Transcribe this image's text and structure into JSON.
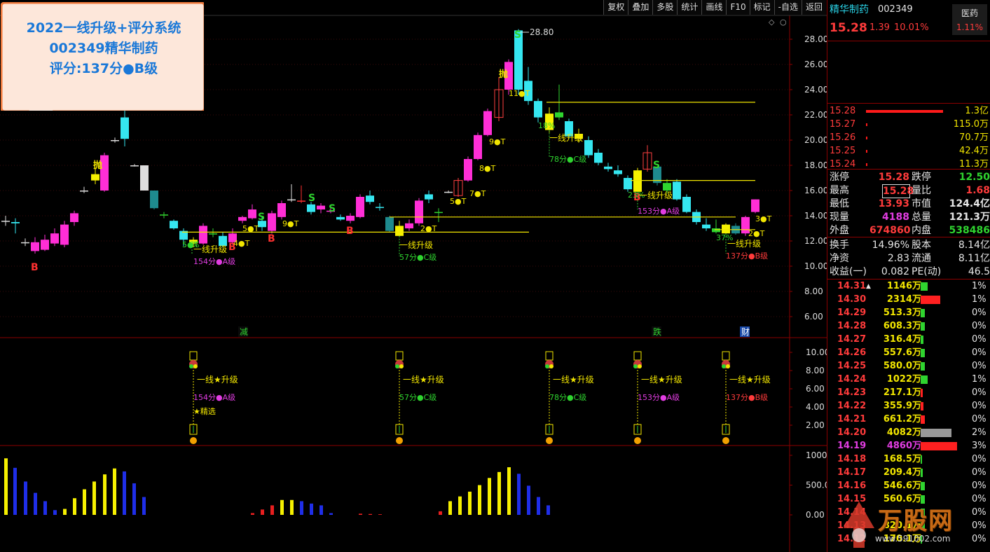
{
  "toolbar": {
    "items": [
      "复权",
      "叠加",
      "多股",
      "统计",
      "画线",
      "F10",
      "标记",
      "-自选",
      "返回"
    ]
  },
  "bubble": {
    "line1": "2022一线升级+评分系统",
    "line2": "002349精华制药",
    "line3": "评分:137分●B级"
  },
  "main_chart": {
    "price_axis": [
      "28.00",
      "26.00",
      "24.00",
      "22.00",
      "20.00",
      "18.00",
      "16.00",
      "14.00",
      "12.00",
      "10.00",
      "8.00",
      "6.00"
    ],
    "peak_label": "28.80",
    "annotations": {
      "pao1": "抛",
      "pao2": "抛",
      "s_labels": [
        "S",
        "S",
        "S",
        "S",
        "S"
      ],
      "b_labels": [
        "B",
        "B",
        "B",
        "B",
        "B"
      ],
      "t_labels": [
        "5●T",
        "4●T",
        "5●T",
        "9●T",
        "2●T",
        "5●T",
        "7●T",
        "8●T",
        "9●T",
        "11●T",
        "2●T",
        "3●T"
      ],
      "pct_labels": [
        "54%",
        "18%",
        "23%",
        "37%"
      ],
      "yixian": [
        "一线升级",
        "一线升级",
        "一线升级",
        "一线升级",
        "一线升级"
      ],
      "scores": [
        {
          "text": "154分●A级",
          "color": "#e23de2"
        },
        {
          "text": "57分●C级",
          "color": "#2fd42f"
        },
        {
          "text": "78分●C级",
          "color": "#2fd42f"
        },
        {
          "text": "153分●A级",
          "color": "#e23de2"
        },
        {
          "text": "137分●B级",
          "color": "#ff3b3b"
        }
      ],
      "events": [
        "减",
        "跌",
        "财"
      ]
    }
  },
  "sub1": {
    "axis": [
      "10.00",
      "8.00",
      "6.00",
      "4.00",
      "2.00"
    ],
    "labels": [
      "一线★升级",
      "一线★升级",
      "一线★升级",
      "一线★升级",
      "一线★升级"
    ],
    "scores": [
      "154分●A级",
      "57分●C级",
      "78分●C级",
      "153分●A级",
      "137分●B级"
    ],
    "jingxuan": "★精选"
  },
  "sub2": {
    "axis": [
      "1000",
      "500.0",
      "0.00"
    ]
  },
  "right_panel": {
    "name": "精华制药",
    "code": "002349",
    "industry": "医药",
    "industry_pct": "1.11%",
    "price": "15.28",
    "change": "1.39",
    "change_pct": "10.01%",
    "bid_rows": [
      {
        "price": "15.28",
        "vol": "1.3亿",
        "bar": 110
      },
      {
        "price": "15.27",
        "vol": "115.0万",
        "bar": 2
      },
      {
        "price": "15.26",
        "vol": "70.7万",
        "bar": 2
      },
      {
        "price": "15.25",
        "vol": "42.4万",
        "bar": 2
      },
      {
        "price": "15.24",
        "vol": "11.3万",
        "bar": 2
      }
    ],
    "stats": [
      {
        "l1": "涨停",
        "v1": "15.28",
        "c1": "red",
        "l2": "跌停",
        "v2": "12.50",
        "c2": "grn"
      },
      {
        "l1": "最高",
        "v1": "15.28",
        "c1": "red",
        "l2": "量比",
        "v2": "1.68",
        "c2": "red",
        "box": true
      },
      {
        "l1": "最低",
        "v1": "13.93",
        "c1": "red",
        "l2": "市值",
        "v2": "124.4亿",
        "c2": "wht"
      },
      {
        "l1": "现量",
        "v1": "4188",
        "c1": "mag",
        "l2": "总量",
        "v2": "121.3万",
        "c2": "wht"
      },
      {
        "l1": "外盘",
        "v1": "674860",
        "c1": "red",
        "l2": "内盘",
        "v2": "538486",
        "c2": "grn"
      }
    ],
    "stats2": [
      {
        "l1": "换手",
        "v1": "14.96%",
        "l2": "股本",
        "v2": "8.14亿"
      },
      {
        "l1": "净资",
        "v1": "2.83",
        "l2": "流通",
        "v2": "8.11亿"
      },
      {
        "l1": "收益(一)",
        "v1": "0.082",
        "l2": "PE(动)",
        "v2": "46.5"
      }
    ],
    "dist": [
      {
        "p": "14.31",
        "v": "1146万",
        "bc": "#2fd42f",
        "bw": 10,
        "pct": "1%",
        "up": true
      },
      {
        "p": "14.30",
        "v": "2314万",
        "bc": "#ff2020",
        "bw": 28,
        "pct": "1%"
      },
      {
        "p": "14.29",
        "v": "513.3万",
        "bc": "#2fd42f",
        "bw": 6,
        "pct": "0%"
      },
      {
        "p": "14.28",
        "v": "608.3万",
        "bc": "#2fd42f",
        "bw": 6,
        "pct": "0%"
      },
      {
        "p": "14.27",
        "v": "316.4万",
        "bc": "#2fd42f",
        "bw": 4,
        "pct": "0%"
      },
      {
        "p": "14.26",
        "v": "557.6万",
        "bc": "#2fd42f",
        "bw": 6,
        "pct": "0%"
      },
      {
        "p": "14.25",
        "v": "580.0万",
        "bc": "#2fd42f",
        "bw": 6,
        "pct": "0%"
      },
      {
        "p": "14.24",
        "v": "1022万",
        "bc": "#2fd42f",
        "bw": 10,
        "pct": "1%"
      },
      {
        "p": "14.23",
        "v": "217.1万",
        "bc": "#ff2020",
        "bw": 3,
        "pct": "0%"
      },
      {
        "p": "14.22",
        "v": "355.9万",
        "bc": "#ff2020",
        "bw": 4,
        "pct": "0%"
      },
      {
        "p": "14.21",
        "v": "661.2万",
        "bc": "#ff2020",
        "bw": 6,
        "pct": "0%"
      },
      {
        "p": "14.20",
        "v": "4082万",
        "bc": "#999",
        "bw": 44,
        "pct": "2%"
      },
      {
        "p": "14.19",
        "v": "4860万",
        "bc": "#ff2020",
        "bw": 52,
        "pct": "3%",
        "mag": true
      },
      {
        "p": "14.18",
        "v": "168.5万",
        "bc": "#2fd42f",
        "bw": 2,
        "pct": "0%"
      },
      {
        "p": "14.17",
        "v": "209.4万",
        "bc": "#2fd42f",
        "bw": 3,
        "pct": "0%"
      },
      {
        "p": "14.16",
        "v": "546.6万",
        "bc": "#2fd42f",
        "bw": 6,
        "pct": "0%"
      },
      {
        "p": "14.15",
        "v": "560.6万",
        "bc": "#2fd42f",
        "bw": 6,
        "pct": "0%"
      },
      {
        "p": "14.14",
        "v": "",
        "bc": "#2fd42f",
        "bw": 6,
        "pct": "0%"
      },
      {
        "p": "14.13",
        "v": "820.1万",
        "bc": "#2fd42f",
        "bw": 6,
        "pct": "0%"
      },
      {
        "p": "14.12",
        "v": "170.1万",
        "bc": "#2fd42f",
        "bw": 2,
        "pct": "0%"
      }
    ],
    "watermark": "万股网",
    "watermark_url": "www.591002.com"
  },
  "colors": {
    "up": "#ff2ed6",
    "down": "#35e6f0",
    "flatYellow": "#f6f000",
    "grid": "#8b0000",
    "line": "#f2e600"
  }
}
